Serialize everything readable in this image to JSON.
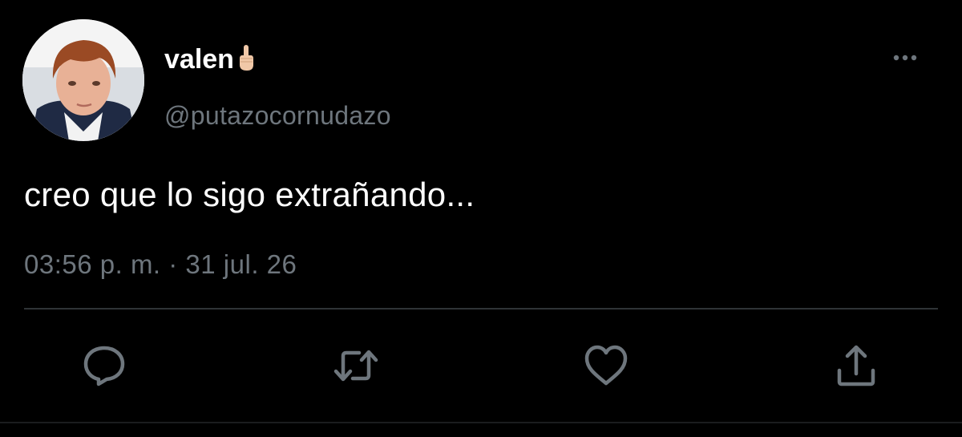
{
  "tweet": {
    "display_name": "valen",
    "username": "@putazocornudazo",
    "text": "creo que lo sigo extrañando...",
    "timestamp": "03:56 p. m. · 31 jul. 26"
  },
  "icons": {
    "name_emoji": "middle-finger-emoji",
    "more": "more-horizontal-icon",
    "reply": "reply-icon",
    "retweet": "retweet-icon",
    "like": "heart-icon",
    "share": "share-icon"
  },
  "colors": {
    "background": "#000000",
    "primary_text": "#ffffff",
    "secondary_text": "#6e767d",
    "icon": "#6e767d",
    "divider": "#2f3336"
  }
}
